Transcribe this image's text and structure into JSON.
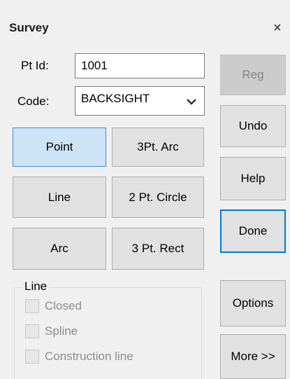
{
  "window": {
    "title": "Survey",
    "close_glyph": "×"
  },
  "form": {
    "pt_id_label": "Pt Id:",
    "pt_id_value": "1001",
    "code_label": "Code:",
    "code_value": "BACKSIGHT"
  },
  "draw_buttons": {
    "point": "Point",
    "arc3pt": "3Pt. Arc",
    "line": "Line",
    "circle2pt": "2 Pt. Circle",
    "arc": "Arc",
    "rect3pt": "3 Pt. Rect"
  },
  "side_buttons": {
    "reg": "Reg",
    "undo": "Undo",
    "help": "Help",
    "done": "Done",
    "options": "Options",
    "more": "More >>"
  },
  "line_group": {
    "title": "Line",
    "closed": "Closed",
    "spline": "Spline",
    "construction": "Construction line"
  }
}
